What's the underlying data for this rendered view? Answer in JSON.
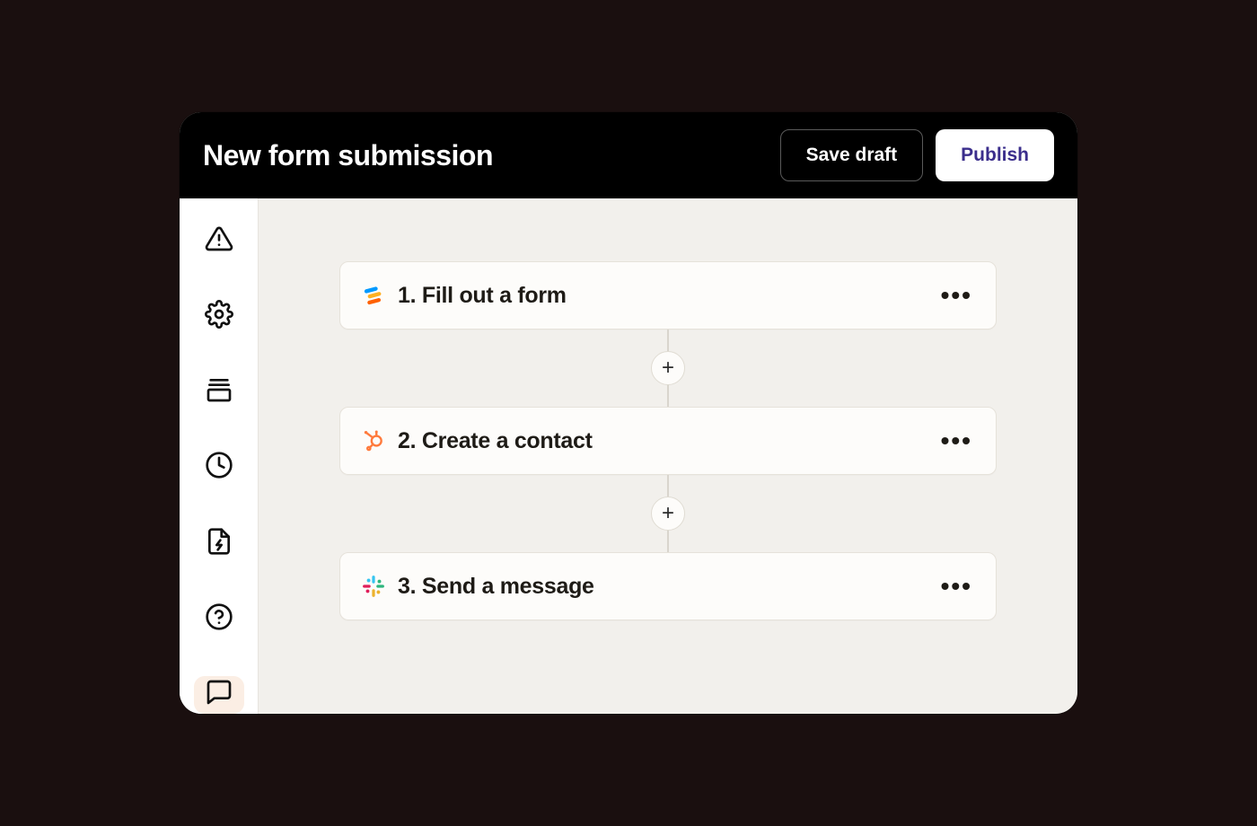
{
  "header": {
    "title": "New form submission",
    "save_draft_label": "Save draft",
    "publish_label": "Publish"
  },
  "sidebar": {
    "items": [
      {
        "name": "alerts"
      },
      {
        "name": "settings"
      },
      {
        "name": "stack"
      },
      {
        "name": "history"
      },
      {
        "name": "power-doc"
      },
      {
        "name": "help"
      },
      {
        "name": "chat",
        "active": true
      }
    ]
  },
  "flow": {
    "steps": [
      {
        "num": "1.",
        "label": "Fill out a form",
        "brand": "jotform"
      },
      {
        "num": "2.",
        "label": "Create a contact",
        "brand": "hubspot"
      },
      {
        "num": "3.",
        "label": "Send a message",
        "brand": "slack"
      }
    ],
    "add_label": "+",
    "more_label": "•••"
  }
}
